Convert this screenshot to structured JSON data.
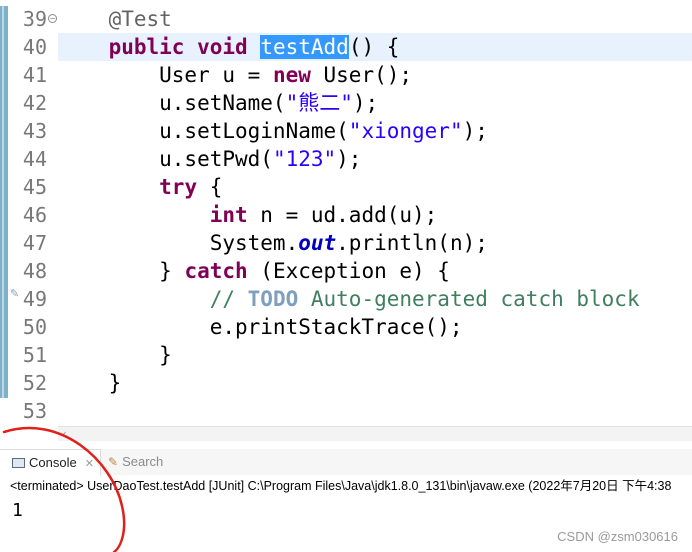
{
  "editor": {
    "line_numbers": [
      "39",
      "40",
      "41",
      "42",
      "43",
      "44",
      "45",
      "46",
      "47",
      "48",
      "49",
      "50",
      "51",
      "52",
      "53"
    ],
    "lines": [
      {
        "t": [
          [
            "    ",
            ""
          ],
          [
            "@Test",
            "ann"
          ]
        ]
      },
      {
        "t": [
          [
            "    ",
            ""
          ],
          [
            "public",
            "kw"
          ],
          [
            " ",
            ""
          ],
          [
            "void",
            "kw"
          ],
          [
            " ",
            ""
          ],
          [
            "testAdd",
            "sel"
          ],
          [
            "() {",
            ""
          ]
        ]
      },
      {
        "t": [
          [
            "        User u = ",
            ""
          ],
          [
            "new",
            "kw"
          ],
          [
            " User();",
            ""
          ]
        ]
      },
      {
        "t": [
          [
            "        u.setName(",
            ""
          ],
          [
            "\"熊二\"",
            "str"
          ],
          [
            ");",
            ""
          ]
        ]
      },
      {
        "t": [
          [
            "        u.setLoginName(",
            ""
          ],
          [
            "\"xionger\"",
            "str"
          ],
          [
            ");",
            ""
          ]
        ]
      },
      {
        "t": [
          [
            "        u.setPwd(",
            ""
          ],
          [
            "\"123\"",
            "str"
          ],
          [
            ");",
            ""
          ]
        ]
      },
      {
        "t": [
          [
            "        ",
            ""
          ],
          [
            "try",
            "kw"
          ],
          [
            " {",
            ""
          ]
        ]
      },
      {
        "t": [
          [
            "            ",
            ""
          ],
          [
            "int",
            "kw"
          ],
          [
            " n = ud.add(u);",
            ""
          ]
        ]
      },
      {
        "t": [
          [
            "            System.",
            ""
          ],
          [
            "out",
            "fld"
          ],
          [
            ".println(n);",
            ""
          ]
        ]
      },
      {
        "t": [
          [
            "        } ",
            ""
          ],
          [
            "catch",
            "kw"
          ],
          [
            " (Exception e) {",
            ""
          ]
        ]
      },
      {
        "t": [
          [
            "            ",
            ""
          ],
          [
            "// ",
            "cmt"
          ],
          [
            "TODO",
            "todo"
          ],
          [
            " Auto-generated catch block",
            "cmt"
          ]
        ]
      },
      {
        "t": [
          [
            "            e.printStackTrace();",
            ""
          ]
        ]
      },
      {
        "t": [
          [
            "        }",
            ""
          ]
        ]
      },
      {
        "t": [
          [
            "    }",
            ""
          ]
        ]
      },
      {
        "t": [
          [
            "",
            ""
          ]
        ]
      }
    ]
  },
  "tabs": {
    "console_label": "Console",
    "console_close": "✕",
    "search_label": "Search"
  },
  "console": {
    "header": "<terminated> UserDaoTest.testAdd [JUnit] C:\\Program Files\\Java\\jdk1.8.0_131\\bin\\javaw.exe (2022年7月20日 下午4:38",
    "output": "1"
  },
  "watermark": "CSDN @zsm030616"
}
